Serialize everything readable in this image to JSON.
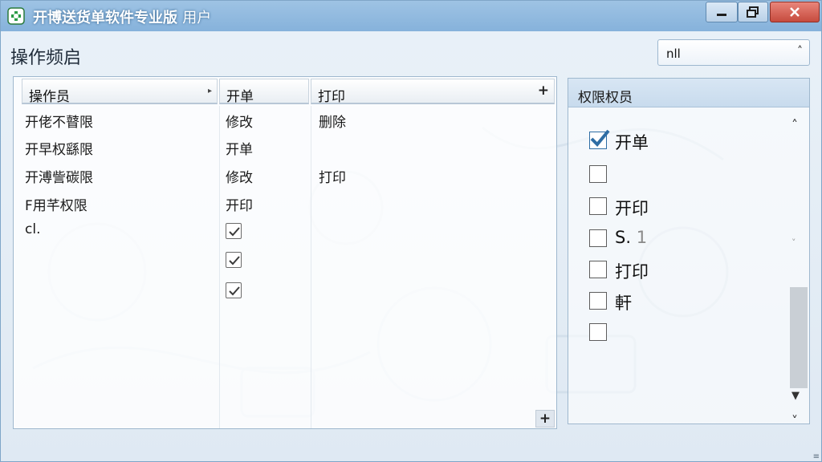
{
  "window": {
    "title": "开博送货单软件专业版",
    "subtitle": "用户",
    "minimize_icon": "minimize-icon",
    "maximize_icon": "restore-icon",
    "close_icon": "close-icon"
  },
  "section": {
    "title": "操作频启"
  },
  "combo": {
    "value": "nll"
  },
  "grid": {
    "headers": [
      "操作员",
      "开单",
      "打印"
    ],
    "rows": [
      [
        "开佬不瞽限",
        "修改",
        "删除"
      ],
      [
        "开早权繇限",
        "开单",
        ""
      ],
      [
        "开溥訾碳限",
        "修改",
        "打印"
      ],
      [
        "F用芊权限",
        "开印",
        ""
      ],
      [
        "cl.",
        "",
        ""
      ]
    ],
    "checkbox_column_values": [
      true,
      true,
      true
    ]
  },
  "permissions": {
    "header": "权限权员",
    "items": [
      {
        "label": "开单",
        "checked": true
      },
      {
        "label": "",
        "checked": false
      },
      {
        "label": "开印",
        "checked": false
      },
      {
        "label": "S.",
        "extra": "1",
        "checked": false
      },
      {
        "label": "打印",
        "checked": false
      },
      {
        "label": "軒",
        "checked": false
      },
      {
        "label": "",
        "checked": false
      }
    ]
  },
  "colors": {
    "titlebar": "#86b2db",
    "close_button": "#c64b3e",
    "check_accent": "#2e6da4"
  }
}
